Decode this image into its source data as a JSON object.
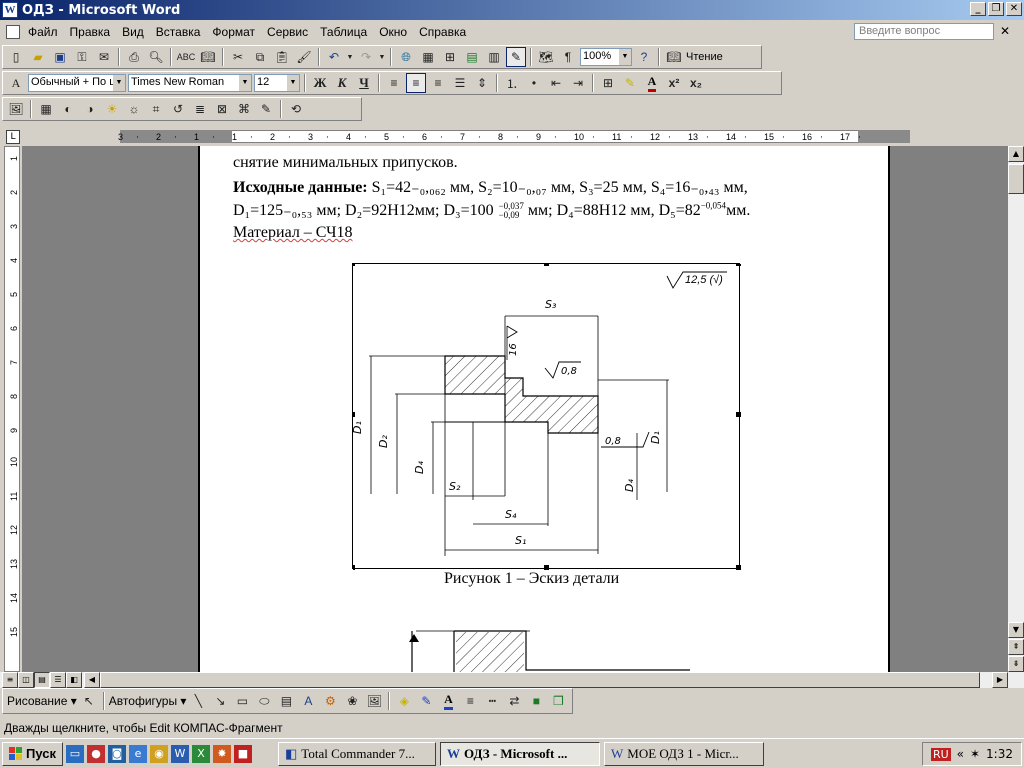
{
  "window": {
    "title": "ОДЗ - Microsoft Word",
    "icon_label": "W"
  },
  "menu": {
    "items": [
      "Файл",
      "Правка",
      "Вид",
      "Вставка",
      "Формат",
      "Сервис",
      "Таблица",
      "Окно",
      "Справка"
    ],
    "ask_placeholder": "Введите вопрос"
  },
  "standard_toolbar": {
    "zoom": "100%",
    "reading_label": "Чтение",
    "para_mark": "¶"
  },
  "format_toolbar": {
    "style": "Обычный + По ц",
    "font": "Times New Roman",
    "size": "12",
    "bold": "Ж",
    "italic": "К",
    "underline": "Ч",
    "letter_a": "A",
    "superscript": "x²",
    "subscript": "x₂"
  },
  "ruler": {
    "numbers": [
      "3",
      "2",
      "1",
      "1",
      "2",
      "3",
      "4",
      "5",
      "6",
      "7",
      "8",
      "9",
      "10",
      "11",
      "12",
      "13",
      "14",
      "15",
      "16",
      "17"
    ]
  },
  "vruler": {
    "numbers": [
      "1",
      "2",
      "3",
      "4",
      "5",
      "6",
      "7",
      "8",
      "9",
      "10",
      "11",
      "12",
      "13",
      "14",
      "15"
    ]
  },
  "document": {
    "line0": "снятие минимальных припусков.",
    "given_label": "Исходные данные:",
    "line1_tail": "S₁=42₋₀,₀₆₂ мм,  S₂=10₋₀,₀₇  мм,  S₃=25  мм,  S₄=16₋₀,₄₃  мм,",
    "line2a": "D₁=125₋₀,₅₃ мм; D₂=92Н12мм; D₃=100",
    "tol_top": "−0,037",
    "tol_bottom": "−0,09",
    "line2b": "мм; D₄=88Н12 мм, D₅=82",
    "d5_tol": "−0,054",
    "line2c": "мм.",
    "material": "Материал –  СЧ18",
    "caption": "Рисунок 1 – Эскиз детали"
  },
  "drawing": {
    "roughness_main": "12,5 (√)",
    "rough_16": "16",
    "rough_08a": "0,8",
    "rough_08b": "0,8",
    "s3": "S₃",
    "s2": "S₂",
    "s4": "S₄",
    "s1": "S₁",
    "d1": "D₁",
    "d2": "D₂",
    "d4": "D₄",
    "d3": "D₃",
    "d1r": "D₁"
  },
  "drawbar": {
    "draw_label": "Рисование ▾",
    "autoshapes_label": "Автофигуры ▾"
  },
  "status": {
    "text": "Дважды щелкните, чтобы Edit КОМПАС-Фрагмент"
  },
  "taskbar": {
    "start": "Пуск",
    "tasks": [
      "Total Commander 7...",
      "ОДЗ - Microsoft ...",
      "МОЕ ОДЗ 1 - Micr..."
    ],
    "lang": "RU",
    "clock": "1:32"
  }
}
